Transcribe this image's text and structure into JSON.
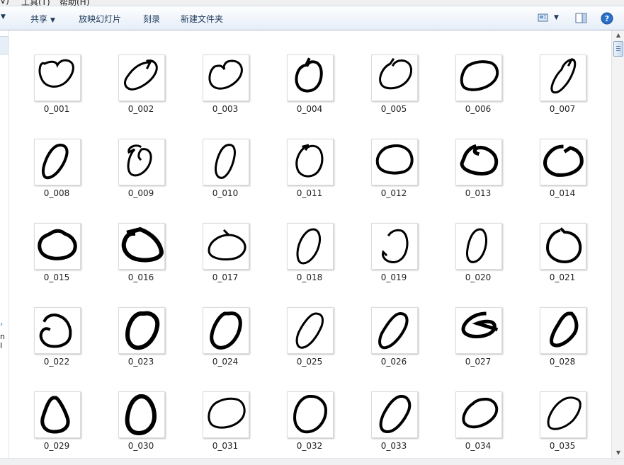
{
  "menubar": {
    "items": [
      "V)",
      "工具(T)",
      "帮助(H)"
    ]
  },
  "toolbar": {
    "share_label": "共享",
    "slideshow_label": "放映幻灯片",
    "burn_label": "刻录",
    "new_folder_label": "新建文件夹",
    "icons": [
      "change-view-icon",
      "preview-pane-icon",
      "help-icon"
    ]
  },
  "nav": {
    "fragment_text": "n I"
  },
  "files": [
    "0_001",
    "0_002",
    "0_003",
    "0_004",
    "0_005",
    "0_006",
    "0_007",
    "0_008",
    "0_009",
    "0_010",
    "0_011",
    "0_012",
    "0_013",
    "0_014",
    "0_015",
    "0_016",
    "0_017",
    "0_018",
    "0_019",
    "0_020",
    "0_021",
    "0_022",
    "0_023",
    "0_024",
    "0_025",
    "0_026",
    "0_027",
    "0_028",
    "0_029",
    "0_030",
    "0_031",
    "0_032",
    "0_033",
    "0_034",
    "0_035"
  ],
  "colors": {
    "accent": "#1e395b",
    "help": "#2a6fc9",
    "ink": "#000000"
  }
}
